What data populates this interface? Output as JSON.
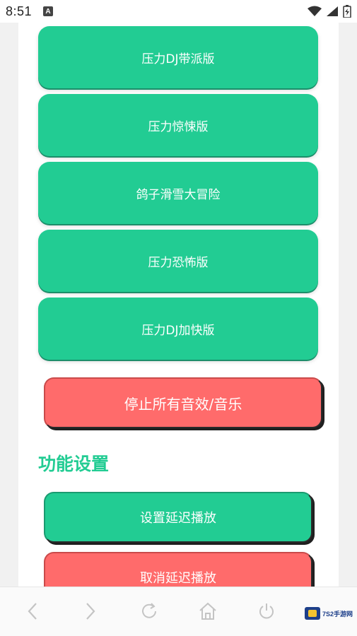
{
  "status_bar": {
    "time": "8:51",
    "app_icon_letter": "A"
  },
  "sound_buttons": [
    {
      "label": "压力DJ带派版"
    },
    {
      "label": "压力惊悚版"
    },
    {
      "label": "鸽子滑雪大冒险"
    },
    {
      "label": "压力恐怖版"
    },
    {
      "label": "压力DJ加快版"
    }
  ],
  "stop_button": {
    "label": "停止所有音效/音乐"
  },
  "settings": {
    "title": "功能设置",
    "set_delay_label": "设置延迟播放",
    "cancel_delay_label": "取消延迟播放"
  },
  "watermark": {
    "text": "7S2手游网"
  },
  "colors": {
    "green": "#22cc93",
    "red": "#ff6b6b"
  }
}
